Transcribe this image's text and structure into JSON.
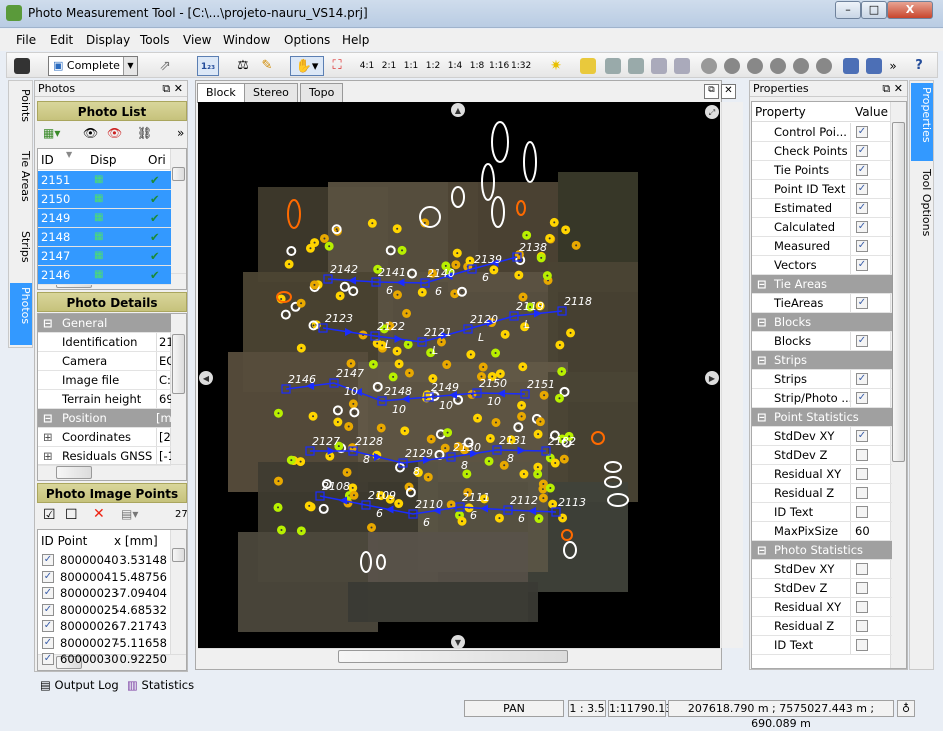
{
  "window": {
    "title": "Photo Measurement Tool - [C:\\...\\projeto-nauru_VS14.prj]",
    "min": "–",
    "max": "□",
    "close": "X"
  },
  "menu": [
    "File",
    "Edit",
    "Display",
    "Tools",
    "View",
    "Window",
    "Options",
    "Help"
  ],
  "toolbar": {
    "mode": "Complete",
    "zooms": [
      "4:1",
      "2:1",
      "1:1",
      "1:2",
      "1:4",
      "1:8",
      "1:16",
      "1:32"
    ],
    "overflow": "»",
    "help": "?"
  },
  "left_vtabs": [
    "Points",
    "Tie Areas",
    "Strips",
    "Photos"
  ],
  "photos_panel": {
    "title": "Photos",
    "photo_list": {
      "title": "Photo List",
      "overflow": "»",
      "columns": [
        "ID",
        "Disp",
        "Ori"
      ],
      "rows": [
        "2151",
        "2150",
        "2149",
        "2148",
        "2147",
        "2146"
      ]
    },
    "photo_details": {
      "title": "Photo Details",
      "rows": [
        {
          "type": "cat",
          "label": "General",
          "value": ""
        },
        {
          "label": "Identification",
          "value": "21!"
        },
        {
          "label": "Camera",
          "value": "EO"
        },
        {
          "label": "Image file",
          "value": "C:\\"
        },
        {
          "label": "Terrain height",
          "value": "69:"
        },
        {
          "type": "cat",
          "label": "Position",
          "value": "[m]"
        },
        {
          "label": "Coordinates",
          "value": "[20",
          "expand": true
        },
        {
          "label": "Residuals GNSS",
          "value": "[-1",
          "expand": true
        }
      ]
    },
    "image_points": {
      "title": "Photo Image Points",
      "count": "27",
      "columns": [
        "ID Point",
        "x [mm]"
      ],
      "rows": [
        {
          "id": "80000040",
          "x": "3.53148"
        },
        {
          "id": "80000041",
          "x": "5.48756"
        },
        {
          "id": "80000023",
          "x": "-7.09404"
        },
        {
          "id": "80000025",
          "x": "-4.68532"
        },
        {
          "id": "80000026",
          "x": "-7.21743"
        },
        {
          "id": "80000027",
          "x": "-5.11658"
        },
        {
          "id": "60000030",
          "x": "0.92250"
        }
      ]
    }
  },
  "bottom_tabs": [
    "Output Log",
    "Statistics"
  ],
  "view_tabs": [
    "Block",
    "Stereo",
    "Topo"
  ],
  "map": {
    "strips": [
      {
        "photos": [
          "2138",
          "2139",
          "2140",
          "2141",
          "2142"
        ],
        "sub": "6"
      },
      {
        "photos": [
          "2118",
          "2119",
          "2120",
          "2121",
          "2122",
          "2123"
        ],
        "sub": "L"
      },
      {
        "photos": [
          "2146",
          "2147",
          "2148",
          "2149",
          "2150",
          "2151"
        ],
        "sub": "10"
      },
      {
        "photos": [
          "2127",
          "2128",
          "2129",
          "2130",
          "2131",
          "2132"
        ],
        "sub": "8"
      },
      {
        "photos": [
          "2108",
          "2109",
          "2110",
          "2111",
          "2112",
          "2113"
        ],
        "sub": "6"
      }
    ],
    "colors": {
      "strip": "#1a2cff",
      "estimated": "#ffd400",
      "calculated": "#b8f000",
      "control": "#ff6a00",
      "check": "#ffffff",
      "tie": "#e8a800"
    }
  },
  "properties": {
    "title": "Properties",
    "columns": [
      "Property",
      "Value"
    ],
    "rows": [
      {
        "label": "Control Poi...",
        "check": true
      },
      {
        "label": "Check Points",
        "check": true
      },
      {
        "label": "Tie Points",
        "check": true
      },
      {
        "label": "Point ID Text",
        "check": true
      },
      {
        "label": "Estimated",
        "check": true
      },
      {
        "label": "Calculated",
        "check": true
      },
      {
        "label": "Measured",
        "check": true
      },
      {
        "label": "Vectors",
        "check": true
      },
      {
        "type": "cat",
        "label": "Tie Areas"
      },
      {
        "label": "TieAreas",
        "check": true
      },
      {
        "type": "cat",
        "label": "Blocks"
      },
      {
        "label": "Blocks",
        "check": true
      },
      {
        "type": "cat",
        "label": "Strips"
      },
      {
        "label": "Strips",
        "check": true
      },
      {
        "label": "Strip/Photo ...",
        "check": true
      },
      {
        "type": "cat",
        "label": "Point Statistics"
      },
      {
        "label": "StdDev XY",
        "check": true
      },
      {
        "label": "StdDev Z",
        "check": false
      },
      {
        "label": "Residual XY",
        "check": false
      },
      {
        "label": "Residual Z",
        "check": false
      },
      {
        "label": "ID Text",
        "check": false
      },
      {
        "label": "MaxPixSize",
        "value": "60"
      },
      {
        "type": "cat",
        "label": "Photo Statistics"
      },
      {
        "label": "StdDev XY",
        "check": false
      },
      {
        "label": "StdDev Z",
        "check": false
      },
      {
        "label": "Residual XY",
        "check": false
      },
      {
        "label": "Residual Z",
        "check": false
      },
      {
        "label": "ID Text",
        "check": false
      }
    ]
  },
  "right_vtabs": [
    "Properties",
    "Tool Options"
  ],
  "status": {
    "mode": "PAN",
    "ratio": "1 : 3.5",
    "scale": "1:11790.13",
    "coords": "207618.790 m ; 7575027.443 m ; 690.089 m"
  }
}
